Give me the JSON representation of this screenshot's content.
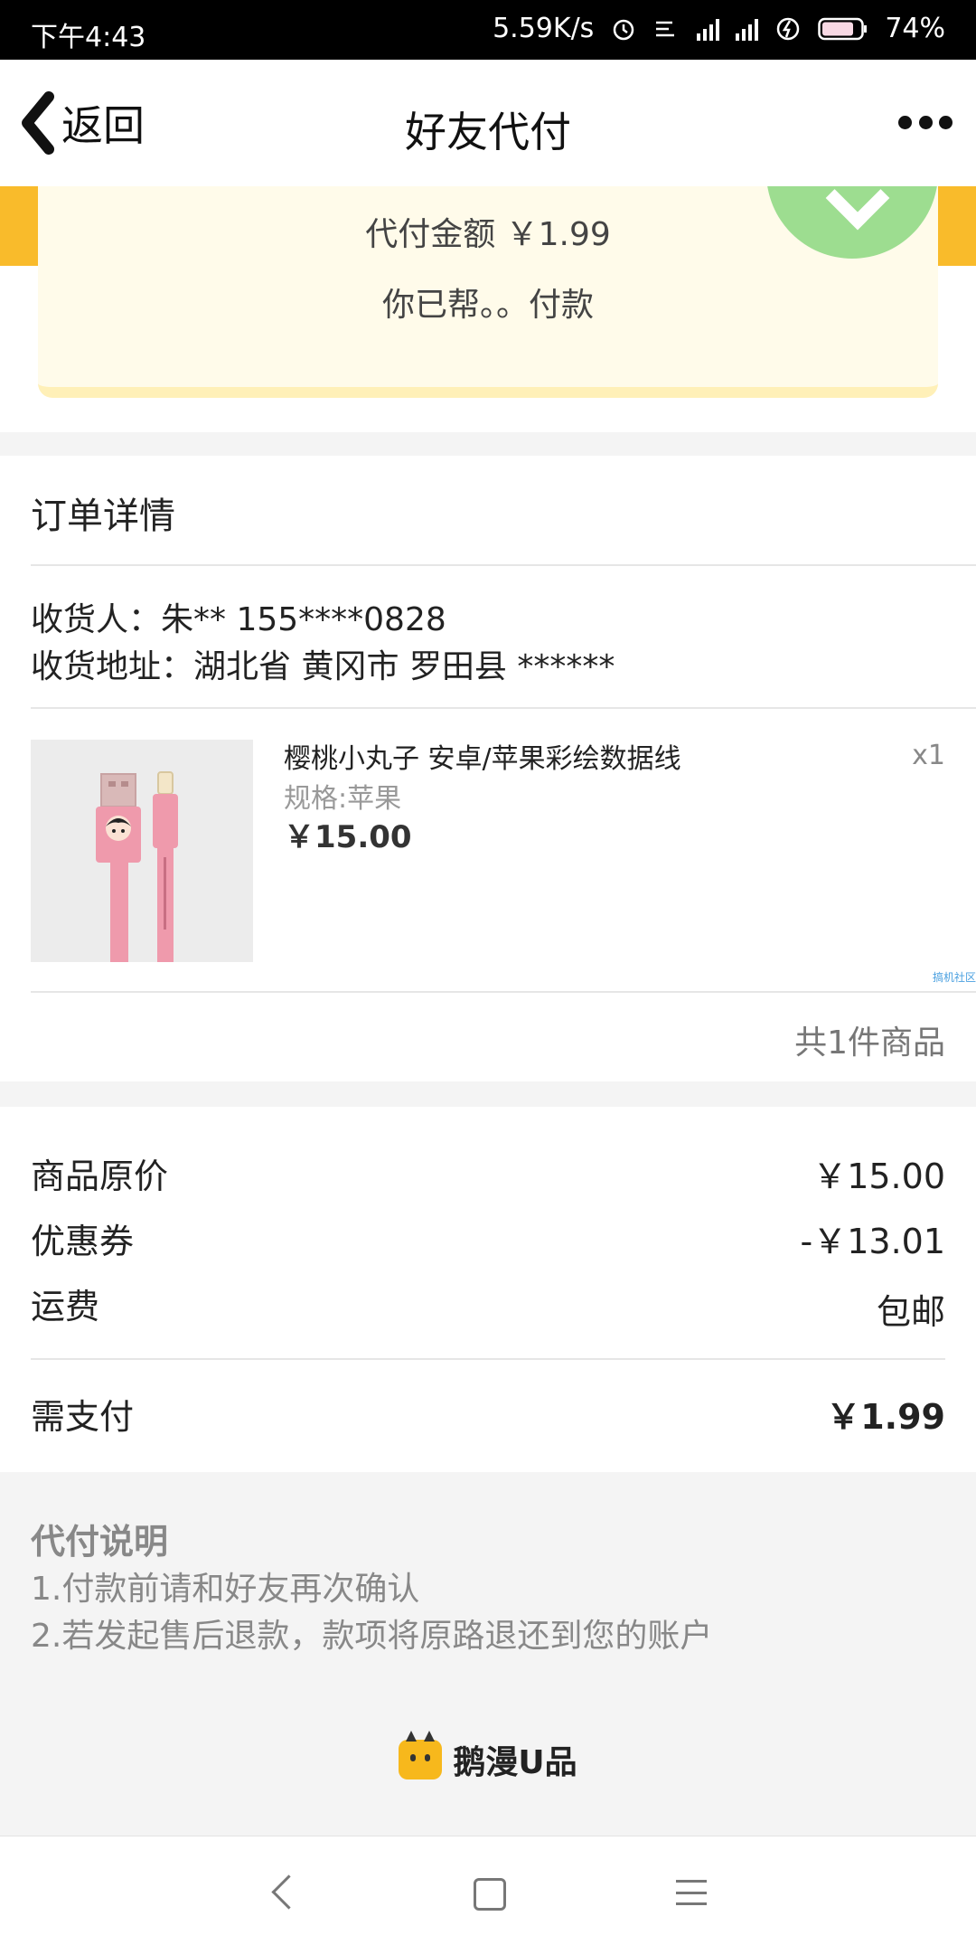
{
  "status_bar": {
    "time": "下午4:43",
    "net_speed": "5.59K/s",
    "battery": "74%"
  },
  "header": {
    "back_label": "返回",
    "title": "好友代付"
  },
  "pay_card": {
    "amount": "代付金额 ￥1.99",
    "helped": "你已帮。。付款"
  },
  "order": {
    "title": "订单详情",
    "receiver": "收货人：朱** 155****0828",
    "address": "收货地址：湖北省 黄冈市 罗田县 ******",
    "product": {
      "name": "樱桃小丸子 安卓/苹果彩绘数据线",
      "spec": "规格:苹果",
      "price": "￥15.00",
      "qty": "x1"
    },
    "watermark": "搞机社区",
    "total_count": "共1件商品"
  },
  "prices": {
    "original_label": "商品原价",
    "original_value": "￥15.00",
    "coupon_label": "优惠券",
    "coupon_value": "-￥13.01",
    "shipping_label": "运费",
    "shipping_value": "包邮",
    "pay_label": "需支付",
    "pay_value": "￥1.99"
  },
  "notes": {
    "title": "代付说明",
    "line1": "1.付款前请和好友再次确认",
    "line2": "2.若发起售后退款，款项将原路退还到您的账户"
  },
  "brand": {
    "name": "鹅漫U品"
  },
  "colors": {
    "accent_yellow": "#f9bb2b",
    "card_bg": "#fffbea",
    "badge_green": "#9ddd90"
  }
}
